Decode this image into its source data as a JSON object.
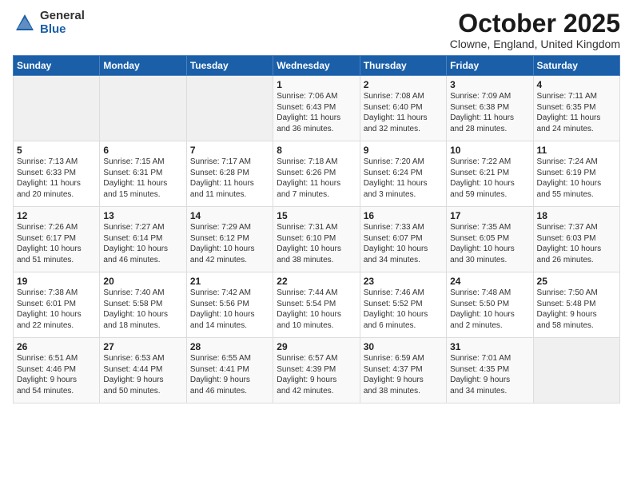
{
  "logo": {
    "general": "General",
    "blue": "Blue"
  },
  "title": "October 2025",
  "location": "Clowne, England, United Kingdom",
  "days_of_week": [
    "Sunday",
    "Monday",
    "Tuesday",
    "Wednesday",
    "Thursday",
    "Friday",
    "Saturday"
  ],
  "weeks": [
    [
      {
        "day": "",
        "info": ""
      },
      {
        "day": "",
        "info": ""
      },
      {
        "day": "",
        "info": ""
      },
      {
        "day": "1",
        "info": "Sunrise: 7:06 AM\nSunset: 6:43 PM\nDaylight: 11 hours\nand 36 minutes."
      },
      {
        "day": "2",
        "info": "Sunrise: 7:08 AM\nSunset: 6:40 PM\nDaylight: 11 hours\nand 32 minutes."
      },
      {
        "day": "3",
        "info": "Sunrise: 7:09 AM\nSunset: 6:38 PM\nDaylight: 11 hours\nand 28 minutes."
      },
      {
        "day": "4",
        "info": "Sunrise: 7:11 AM\nSunset: 6:35 PM\nDaylight: 11 hours\nand 24 minutes."
      }
    ],
    [
      {
        "day": "5",
        "info": "Sunrise: 7:13 AM\nSunset: 6:33 PM\nDaylight: 11 hours\nand 20 minutes."
      },
      {
        "day": "6",
        "info": "Sunrise: 7:15 AM\nSunset: 6:31 PM\nDaylight: 11 hours\nand 15 minutes."
      },
      {
        "day": "7",
        "info": "Sunrise: 7:17 AM\nSunset: 6:28 PM\nDaylight: 11 hours\nand 11 minutes."
      },
      {
        "day": "8",
        "info": "Sunrise: 7:18 AM\nSunset: 6:26 PM\nDaylight: 11 hours\nand 7 minutes."
      },
      {
        "day": "9",
        "info": "Sunrise: 7:20 AM\nSunset: 6:24 PM\nDaylight: 11 hours\nand 3 minutes."
      },
      {
        "day": "10",
        "info": "Sunrise: 7:22 AM\nSunset: 6:21 PM\nDaylight: 10 hours\nand 59 minutes."
      },
      {
        "day": "11",
        "info": "Sunrise: 7:24 AM\nSunset: 6:19 PM\nDaylight: 10 hours\nand 55 minutes."
      }
    ],
    [
      {
        "day": "12",
        "info": "Sunrise: 7:26 AM\nSunset: 6:17 PM\nDaylight: 10 hours\nand 51 minutes."
      },
      {
        "day": "13",
        "info": "Sunrise: 7:27 AM\nSunset: 6:14 PM\nDaylight: 10 hours\nand 46 minutes."
      },
      {
        "day": "14",
        "info": "Sunrise: 7:29 AM\nSunset: 6:12 PM\nDaylight: 10 hours\nand 42 minutes."
      },
      {
        "day": "15",
        "info": "Sunrise: 7:31 AM\nSunset: 6:10 PM\nDaylight: 10 hours\nand 38 minutes."
      },
      {
        "day": "16",
        "info": "Sunrise: 7:33 AM\nSunset: 6:07 PM\nDaylight: 10 hours\nand 34 minutes."
      },
      {
        "day": "17",
        "info": "Sunrise: 7:35 AM\nSunset: 6:05 PM\nDaylight: 10 hours\nand 30 minutes."
      },
      {
        "day": "18",
        "info": "Sunrise: 7:37 AM\nSunset: 6:03 PM\nDaylight: 10 hours\nand 26 minutes."
      }
    ],
    [
      {
        "day": "19",
        "info": "Sunrise: 7:38 AM\nSunset: 6:01 PM\nDaylight: 10 hours\nand 22 minutes."
      },
      {
        "day": "20",
        "info": "Sunrise: 7:40 AM\nSunset: 5:58 PM\nDaylight: 10 hours\nand 18 minutes."
      },
      {
        "day": "21",
        "info": "Sunrise: 7:42 AM\nSunset: 5:56 PM\nDaylight: 10 hours\nand 14 minutes."
      },
      {
        "day": "22",
        "info": "Sunrise: 7:44 AM\nSunset: 5:54 PM\nDaylight: 10 hours\nand 10 minutes."
      },
      {
        "day": "23",
        "info": "Sunrise: 7:46 AM\nSunset: 5:52 PM\nDaylight: 10 hours\nand 6 minutes."
      },
      {
        "day": "24",
        "info": "Sunrise: 7:48 AM\nSunset: 5:50 PM\nDaylight: 10 hours\nand 2 minutes."
      },
      {
        "day": "25",
        "info": "Sunrise: 7:50 AM\nSunset: 5:48 PM\nDaylight: 9 hours\nand 58 minutes."
      }
    ],
    [
      {
        "day": "26",
        "info": "Sunrise: 6:51 AM\nSunset: 4:46 PM\nDaylight: 9 hours\nand 54 minutes."
      },
      {
        "day": "27",
        "info": "Sunrise: 6:53 AM\nSunset: 4:44 PM\nDaylight: 9 hours\nand 50 minutes."
      },
      {
        "day": "28",
        "info": "Sunrise: 6:55 AM\nSunset: 4:41 PM\nDaylight: 9 hours\nand 46 minutes."
      },
      {
        "day": "29",
        "info": "Sunrise: 6:57 AM\nSunset: 4:39 PM\nDaylight: 9 hours\nand 42 minutes."
      },
      {
        "day": "30",
        "info": "Sunrise: 6:59 AM\nSunset: 4:37 PM\nDaylight: 9 hours\nand 38 minutes."
      },
      {
        "day": "31",
        "info": "Sunrise: 7:01 AM\nSunset: 4:35 PM\nDaylight: 9 hours\nand 34 minutes."
      },
      {
        "day": "",
        "info": ""
      }
    ]
  ]
}
